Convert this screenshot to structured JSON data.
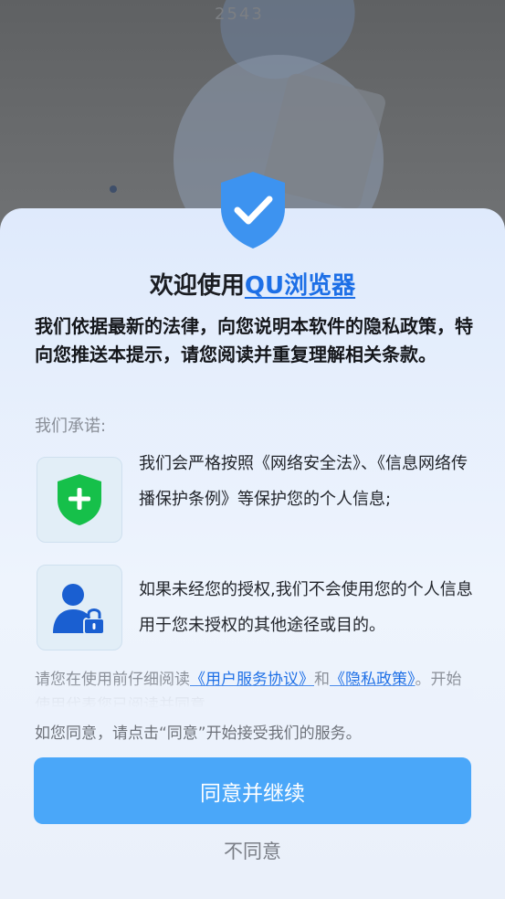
{
  "background": {
    "watermark": "2543"
  },
  "dialog": {
    "title_prefix": "欢迎使用",
    "app_name": "QU浏览器",
    "intro": "我们依据最新的法律，向您说明本软件的隐私政策，特向您推送本提示，请您阅读并重复理解相关条款。",
    "promise_label": "我们承诺:",
    "promises": [
      {
        "icon": "green-shield-plus-icon",
        "text": "我们会严格按照《网络安全法》、《信息网络传播保护条例》等保护您的个人信息;"
      },
      {
        "icon": "user-lock-icon",
        "text": "如果未经您的授权,我们不会使用您的个人信息用于您未授权的其他途径或目的。"
      }
    ],
    "notice": {
      "before": "请您在使用前仔细阅读",
      "user_agreement": "《用户服务协议》",
      "and": "和",
      "privacy_policy": "《隐私政策》",
      "after": "。开始使用代表您已阅读并同意"
    },
    "hint": "如您同意，请点击“同意”开始接受我们的服务。",
    "agree_label": "同意并继续",
    "disagree_label": "不同意"
  },
  "colors": {
    "accent": "#4aa7f9",
    "link": "#1d6fe6",
    "shield_blue": "#3d93f0",
    "shield_green": "#16c04a"
  }
}
